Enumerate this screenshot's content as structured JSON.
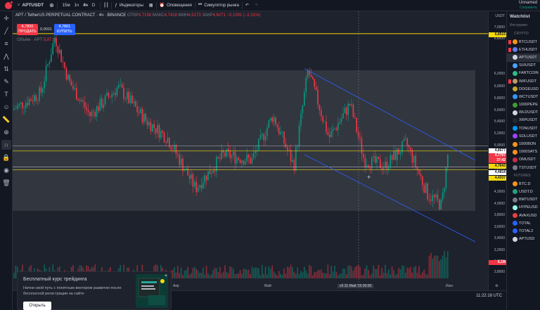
{
  "header": {
    "symbol": "APTUSDT",
    "timeframes": [
      "15м",
      "1ч",
      "4ч",
      "D"
    ],
    "active_timeframe": "4ч",
    "indicators_label": "Индикаторы",
    "alerts_label": "Оповещения",
    "simulator_label": "Симулятор рынка",
    "user_name": "Unnamed",
    "user_sub": "Сохранить"
  },
  "legend": {
    "title": "APT / TetherUS PERPETUAL CONTRACT · 4ч · BINANCE",
    "open_label": "ОТКР",
    "open": "4,7158",
    "high_label": "МАКС",
    "high": "4,7418",
    "low_label": "МИН",
    "low": "4,5173",
    "close_label": "ЗАКР",
    "close": "4,6271",
    "change": "−0,1091 (−2,31%)"
  },
  "trade": {
    "sell_price": "4,7800",
    "sell_label": "ПРОДАТЬ",
    "spread": "0,0001",
    "buy_price": "4,7801",
    "buy_label": "КУПИТЬ"
  },
  "volume": {
    "label": "Объём · APT",
    "value": "5,87 M"
  },
  "price_scale": {
    "currency": "USDT",
    "labels": [
      "7,0000",
      "6,6000",
      "6,2000",
      "6,0000",
      "5,8000",
      "5,6000",
      "5,4000",
      "5,2000",
      "5,0000",
      "4,8000",
      "4,6000",
      "4,4000",
      "4,2000",
      "4,0000",
      "3,8000",
      "3,6000",
      "3,4000",
      "3,2000",
      "3,0000",
      "2,8000"
    ],
    "tags": [
      {
        "text": "6,8515",
        "bg": "#f5d90a",
        "fg": "#131722"
      },
      {
        "text": "4,8577",
        "bg": "#ffffff",
        "fg": "#131722"
      },
      {
        "text": "4,7797",
        "bg": "#f23645",
        "fg": "#ffffff"
      },
      {
        "text": "37:42",
        "bg": "#f23645",
        "fg": "#ffffff"
      },
      {
        "text": "4,7643",
        "bg": "#f5d90a",
        "fg": "#131722"
      },
      {
        "text": "4,4818",
        "bg": "#ffffff",
        "fg": "#131722"
      },
      {
        "text": "4,4337",
        "bg": "#f5d90a",
        "fg": "#131722"
      },
      {
        "text": "6,1M",
        "bg": "#f23645",
        "fg": "#ffffff"
      }
    ]
  },
  "time_axis": {
    "labels": [
      "Апр",
      "Май",
      "Июн"
    ],
    "crosshair_label": "сб 31 Май '25   00:00",
    "clock": "11:22:18 UTC"
  },
  "promo": {
    "title": "Бесплатный курс трейдинга",
    "text": "Начни свой путь с понятным вектором развития после бесплатной регистрации на сайте",
    "button": "Открыть"
  },
  "watchlist": {
    "title": "Watchlist",
    "subtitle": "Инструмен",
    "section_crypto": "CRYPTO",
    "section_futures": "FUTURES",
    "crypto": [
      {
        "name": "BTCUSDT",
        "color": "#f7931a",
        "flag": "#f23645"
      },
      {
        "name": "ETHUSDT",
        "color": "#627eea",
        "flag": "#f23645"
      },
      {
        "name": "APTUSDT",
        "color": "#d1d4dc",
        "flag": "",
        "selected": true
      },
      {
        "name": "SUIUSDT",
        "color": "#4da2ff",
        "flag": ""
      },
      {
        "name": "FARTCOIN",
        "color": "#2ebd85",
        "flag": ""
      },
      {
        "name": "WIFUSDT",
        "color": "#c49a6c",
        "flag": "#f23645"
      },
      {
        "name": "DOGEUSD",
        "color": "#c2a633",
        "flag": ""
      },
      {
        "name": "WCTUSDT",
        "color": "#3396ff",
        "flag": ""
      },
      {
        "name": "1000PEPE",
        "color": "#3e9c35",
        "flag": ""
      },
      {
        "name": "WLDUSDT",
        "color": "#d1d4dc",
        "flag": ""
      },
      {
        "name": "XRPUSDT",
        "color": "#23292f",
        "flag": ""
      },
      {
        "name": "TONUSDT",
        "color": "#0098ea",
        "flag": ""
      },
      {
        "name": "SOLUSDT",
        "color": "#9945ff",
        "flag": ""
      },
      {
        "name": "1000BON",
        "color": "#f7931a",
        "flag": ""
      },
      {
        "name": "1000SATS",
        "color": "#f7931a",
        "flag": ""
      },
      {
        "name": "OMUSDT",
        "color": "#c72c48",
        "flag": ""
      },
      {
        "name": "TSTUSDT",
        "color": "#787b86",
        "flag": ""
      }
    ],
    "futures": [
      {
        "name": "BTC.D",
        "color": "#f7931a",
        "flag": ""
      },
      {
        "name": "USDT.D",
        "color": "#26a17b",
        "flag": ""
      },
      {
        "name": "BMTUSDT",
        "color": "#787b86",
        "flag": ""
      },
      {
        "name": "HYPEUSD",
        "color": "#97fce4",
        "flag": ""
      },
      {
        "name": "AVAXUSD",
        "color": "#e84142",
        "flag": ""
      },
      {
        "name": "TOTAL",
        "color": "#2962ff",
        "flag": ""
      },
      {
        "name": "TOTAL2",
        "color": "#2962ff",
        "flag": ""
      },
      {
        "name": "APTUSD",
        "color": "#d1d4dc",
        "flag": ""
      }
    ]
  },
  "chart_colors": {
    "up": "#089981",
    "down": "#f23645",
    "channel": "#2962ff",
    "hline_yellow": "#f5d90a"
  }
}
